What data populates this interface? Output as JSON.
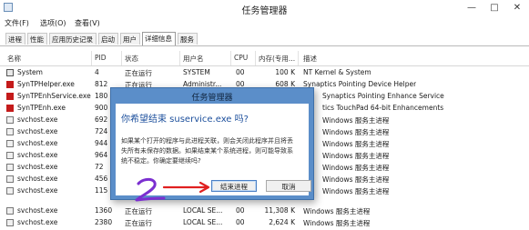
{
  "window": {
    "title": "任务管理器",
    "minimize_glyph": "—",
    "maximize_glyph": "□",
    "close_glyph": "✕"
  },
  "menu": [
    "文件(F)",
    "选项(O)",
    "查看(V)"
  ],
  "tabs": [
    "进程",
    "性能",
    "应用历史记录",
    "启动",
    "用户",
    "详细信息",
    "服务"
  ],
  "active_tab": "详细信息",
  "table": {
    "columns": [
      "名称",
      "PID",
      "状态",
      "用户名",
      "CPU",
      "内存(专用...",
      "描述"
    ],
    "rows": [
      {
        "name": "System",
        "pid": "4",
        "status": "正在运行",
        "user": "SYSTEM",
        "cpu": "00",
        "mem": "100 K",
        "desc": "NT Kernel & System",
        "icon": "system-icon"
      },
      {
        "name": "SynTPHelper.exe",
        "pid": "812",
        "status": "正在运行",
        "user": "Administr...",
        "cpu": "00",
        "mem": "608 K",
        "desc": "Synaptics Pointing Device Helper",
        "icon": "synaptics-icon"
      },
      {
        "name": "SynTPEnhService.exe",
        "pid": "180",
        "status": "",
        "user": "",
        "cpu": "",
        "mem": "",
        "desc": "Synaptics Pointing Enhance Service",
        "icon": "synaptics-icon"
      },
      {
        "name": "SynTPEnh.exe",
        "pid": "900",
        "status": "",
        "user": "",
        "cpu": "",
        "mem": "",
        "desc": "tics TouchPad 64-bit Enhancements",
        "icon": "synaptics-icon"
      },
      {
        "name": "svchost.exe",
        "pid": "692",
        "status": "",
        "user": "",
        "cpu": "",
        "mem": "",
        "desc": "Windows 服务主进程",
        "icon": "service-icon"
      },
      {
        "name": "svchost.exe",
        "pid": "724",
        "status": "",
        "user": "",
        "cpu": "",
        "mem": "",
        "desc": "Windows 服务主进程",
        "icon": "service-icon"
      },
      {
        "name": "svchost.exe",
        "pid": "944",
        "status": "",
        "user": "",
        "cpu": "",
        "mem": "",
        "desc": "Windows 服务主进程",
        "icon": "service-icon"
      },
      {
        "name": "svchost.exe",
        "pid": "964",
        "status": "",
        "user": "",
        "cpu": "",
        "mem": "",
        "desc": "Windows 服务主进程",
        "icon": "service-icon"
      },
      {
        "name": "svchost.exe",
        "pid": "72",
        "status": "",
        "user": "",
        "cpu": "",
        "mem": "",
        "desc": "Windows 服务主进程",
        "icon": "service-icon"
      },
      {
        "name": "svchost.exe",
        "pid": "456",
        "status": "",
        "user": "",
        "cpu": "",
        "mem": "",
        "desc": "Windows 服务主进程",
        "icon": "service-icon"
      },
      {
        "name": "svchost.exe",
        "pid": "115",
        "status": "",
        "user": "",
        "cpu": "",
        "mem": "",
        "desc": "Windows 服务主进程",
        "icon": "service-icon"
      },
      {
        "name": "svchost.exe",
        "pid": "1360",
        "status": "正在运行",
        "user": "LOCAL SE...",
        "cpu": "00",
        "mem": "11,308 K",
        "desc": "Windows 服务主进程",
        "icon": "service-icon"
      },
      {
        "name": "svchost.exe",
        "pid": "2380",
        "status": "正在运行",
        "user": "LOCAL SE...",
        "cpu": "00",
        "mem": "2,624 K",
        "desc": "Windows 服务主进程",
        "icon": "service-icon"
      }
    ]
  },
  "dialog": {
    "title": "任务管理器",
    "heading": "你希望结束 suservice.exe 吗?",
    "text_lines": [
      "如果某个打开的程序与此进程关联，则会关闭此程序并且将丢",
      "失所有未保存的数据。如果结束某个系统进程，则可能导致系",
      "统不稳定。你确定要继续吗?"
    ],
    "end_button": "结束进程",
    "cancel_button": "取消"
  },
  "annotation_color": "#7b2fd0",
  "arrow_color": "#e02020"
}
